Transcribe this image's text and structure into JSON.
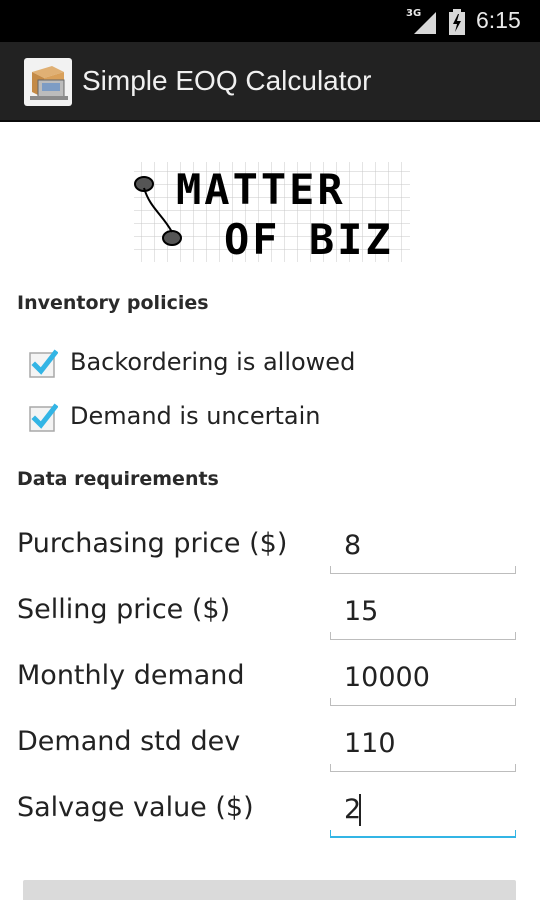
{
  "status_bar": {
    "network": "3G",
    "time": "6:15",
    "icons": [
      "signal-icon",
      "battery-charging-icon"
    ]
  },
  "action_bar": {
    "title": "Simple EOQ Calculator",
    "icon": "app-box-icon"
  },
  "logo": {
    "line1": "MATTER",
    "line2": "OF BIZ"
  },
  "inventory_policies": {
    "header": "Inventory policies",
    "options": [
      {
        "label": "Backordering is allowed",
        "checked": true
      },
      {
        "label": "Demand is uncertain",
        "checked": true
      }
    ]
  },
  "data_requirements": {
    "header": "Data requirements",
    "fields": [
      {
        "label": "Purchasing price ($)",
        "value": "8"
      },
      {
        "label": "Selling price ($)",
        "value": "15"
      },
      {
        "label": "Monthly demand",
        "value": "10000"
      },
      {
        "label": "Demand std dev",
        "value": "110"
      },
      {
        "label": "Salvage value ($)",
        "value": "2",
        "focused": true
      }
    ]
  },
  "colors": {
    "action_bar": "#222222",
    "status_bar": "#000000",
    "accent": "#33b5e5",
    "underline": "#bdbdbd"
  }
}
